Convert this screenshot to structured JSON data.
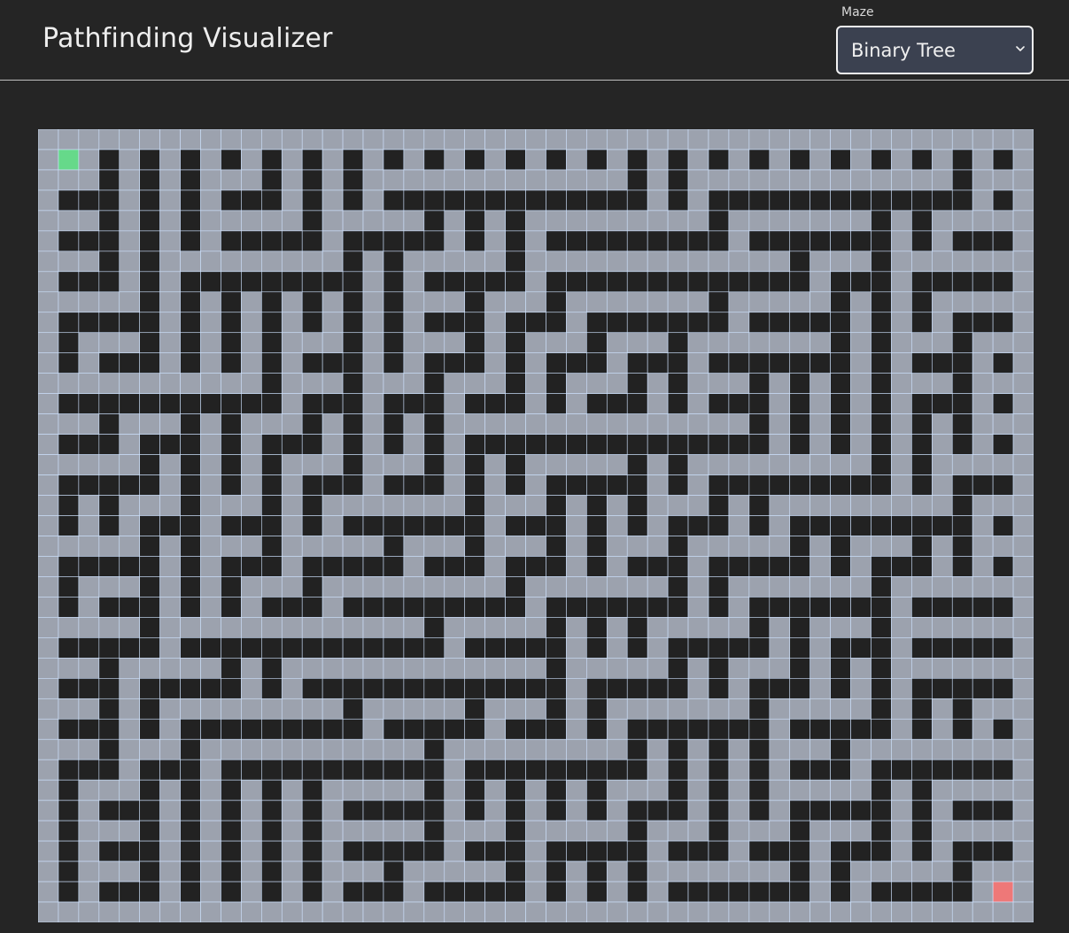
{
  "header": {
    "title": "Pathfinding Visualizer"
  },
  "maze_control": {
    "label": "Maze",
    "selected_value": "Binary Tree"
  },
  "icons": {
    "select_arrow": "chevron-down-icon"
  },
  "colors": {
    "background": "#252525",
    "open_cell": "#9ca2ae",
    "wall_cell": "#222222",
    "grid_line": "#cfe3ff",
    "start_node": "#66d98a",
    "end_node": "#ee7878"
  },
  "grid": {
    "rows": 39,
    "cols": 49,
    "start": {
      "row": 1,
      "col": 1
    },
    "end": {
      "row": 37,
      "col": 47
    }
  }
}
